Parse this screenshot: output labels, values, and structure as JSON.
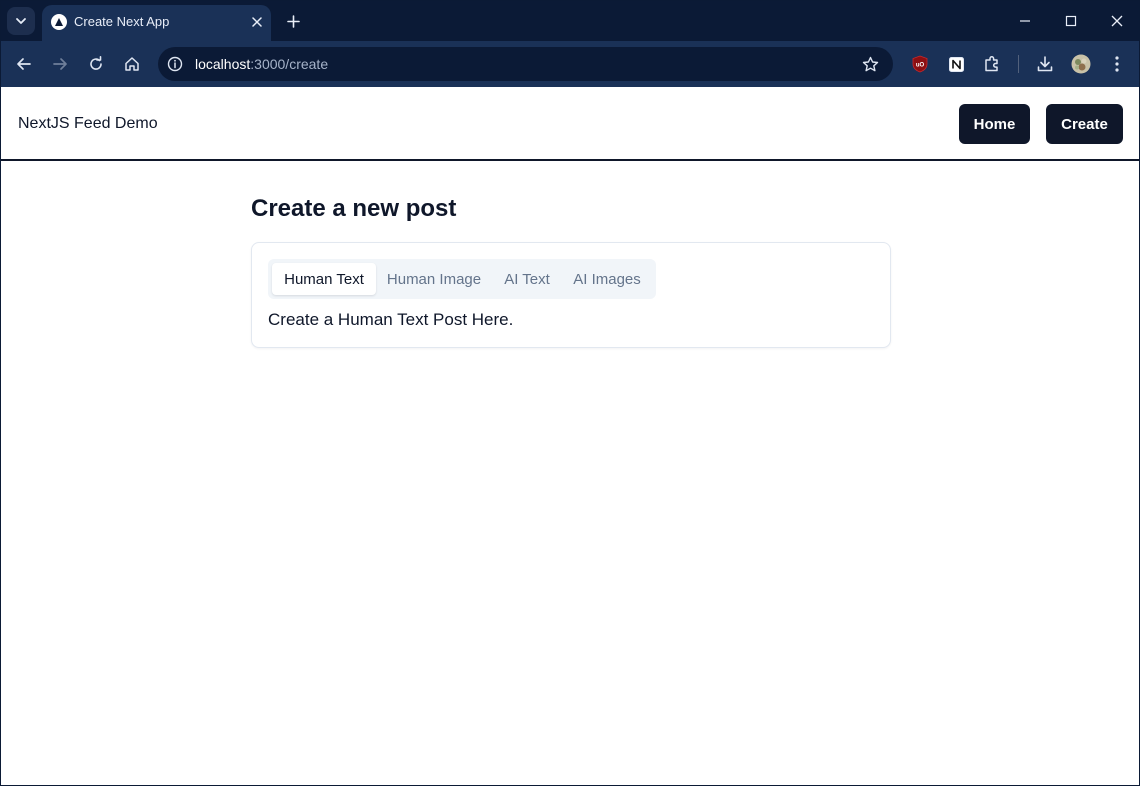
{
  "browser": {
    "tab": {
      "title": "Create Next App"
    },
    "address": {
      "host": "localhost",
      "path": ":3000/create"
    }
  },
  "site": {
    "brand": "NextJS Feed Demo",
    "nav": {
      "home_label": "Home",
      "create_label": "Create"
    }
  },
  "main": {
    "heading": "Create a new post",
    "tabs": [
      {
        "label": "Human Text",
        "active": true
      },
      {
        "label": "Human Image",
        "active": false
      },
      {
        "label": "AI Text",
        "active": false
      },
      {
        "label": "AI Images",
        "active": false
      }
    ],
    "content": "Create a Human Text Post Here."
  },
  "colors": {
    "titlebar": "#0b1a36",
    "toolbar": "#1a3157",
    "primary": "#0f172a",
    "tabs_bg": "#f1f5f9",
    "muted_text": "#64748b"
  },
  "icons": [
    "chevron-down-icon",
    "nextjs-favicon-icon",
    "close-icon",
    "plus-icon",
    "minimize-icon",
    "maximize-icon",
    "back-arrow-icon",
    "forward-arrow-icon",
    "reload-icon",
    "home-icon",
    "info-icon",
    "star-icon",
    "ublock-shield-icon",
    "notion-icon",
    "puzzle-icon",
    "download-icon",
    "avatar-icon",
    "more-vertical-icon"
  ]
}
